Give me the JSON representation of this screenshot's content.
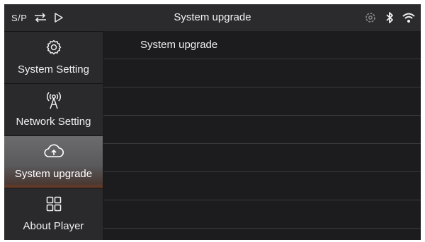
{
  "status_bar": {
    "source_label": "S/P",
    "title": "System upgrade",
    "icons": [
      "switch-arrows-icon",
      "play-icon",
      "settings-cog-icon",
      "bluetooth-icon",
      "wifi-icon"
    ]
  },
  "sidebar": {
    "items": [
      {
        "label": "System Setting",
        "icon": "gear-icon",
        "active": false
      },
      {
        "label": "Network Setting",
        "icon": "antenna-icon",
        "active": false
      },
      {
        "label": "System upgrade",
        "icon": "cloud-upload-icon",
        "active": true
      },
      {
        "label": "About Player",
        "icon": "grid-icon",
        "active": false
      }
    ]
  },
  "main": {
    "rows": [
      {
        "label": "System upgrade"
      },
      {
        "label": ""
      },
      {
        "label": ""
      },
      {
        "label": ""
      },
      {
        "label": ""
      },
      {
        "label": ""
      },
      {
        "label": ""
      }
    ]
  },
  "colors": {
    "background": "#1a1a1c",
    "status_bar": "#2b2b2e",
    "sidebar_item": "#2a2a2d",
    "active_item": "#5f5f62",
    "divider": "#3a3a3d",
    "text": "#f0f0f0"
  }
}
